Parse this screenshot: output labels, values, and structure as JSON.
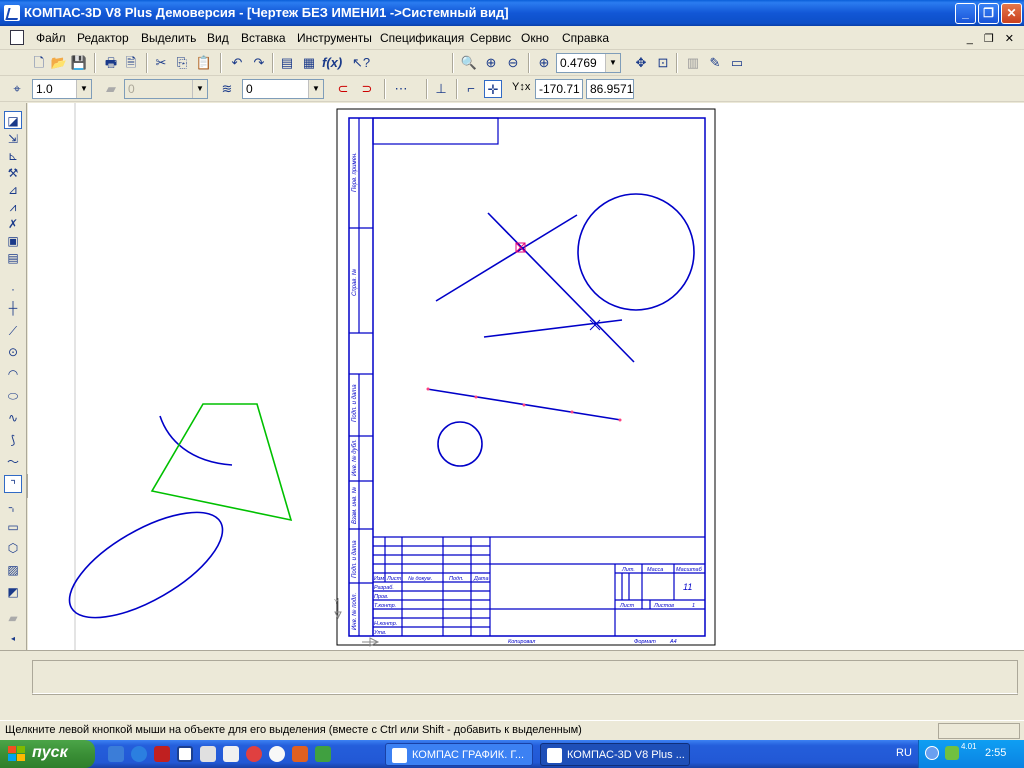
{
  "window": {
    "title": "КОМПАС-3D V8 Plus Демоверсия - [Чертеж БЕЗ ИМЕНИ1 ->Системный вид]",
    "controls": [
      "_",
      "❐",
      "✕"
    ]
  },
  "menu": {
    "items": [
      "Файл",
      "Редактор",
      "Выделить",
      "Вид",
      "Вставка",
      "Инструменты",
      "Спецификация",
      "Сервис",
      "Окно",
      "Справка"
    ],
    "mdi_controls": "_ ❐ ✕"
  },
  "toolbar1": {
    "zoom_value": "0.4769"
  },
  "toolbar2": {
    "step_value": "1.0",
    "layer_combo": "0",
    "style_combo": "0",
    "coord_label": "Y↕x",
    "coord_x": "-170.71",
    "coord_y": "86.9571"
  },
  "drawing": {
    "stamp_labels": {
      "vert": [
        "Перв. примен.",
        "Справ. №",
        "Подп. и дата",
        "Инв. № дубл.",
        "Взам. инв. №",
        "Подп. и дата",
        "Инв. № подл."
      ],
      "izm": "Изм.",
      "list": "Лист",
      "ndokum": "№ докум.",
      "podp": "Подп.",
      "data": "Дата",
      "razrab": "Разраб.",
      "prov": "Пров.",
      "tkontr": "Т.контр.",
      "nkontr": "Н.контр.",
      "utv": "Утв.",
      "lit": "Лит.",
      "massa": "Масса",
      "masshtab": "Масштаб",
      "scale_value": "11",
      "list2": "Лист",
      "listov": "Листов",
      "listov_value": "1",
      "kopiroval": "Копировал",
      "format": "Формат",
      "format_value": "А4"
    }
  },
  "status": {
    "text": "Щелкните левой кнопкой мыши на объекте для его выделения (вместе с Ctrl или Shift - добавить к выделенным)"
  },
  "taskbar": {
    "start_label": "пуск",
    "tasks": [
      "КОМПАС ГРАФИК. Г...",
      "КОМПАС-3D V8 Plus ..."
    ],
    "lang": "RU",
    "tray_value": "4.01",
    "clock": "2:55"
  },
  "colors": {
    "geometry_blue": "#0000c8",
    "spline_green": "#00c000",
    "point_red": "#ff4080"
  }
}
